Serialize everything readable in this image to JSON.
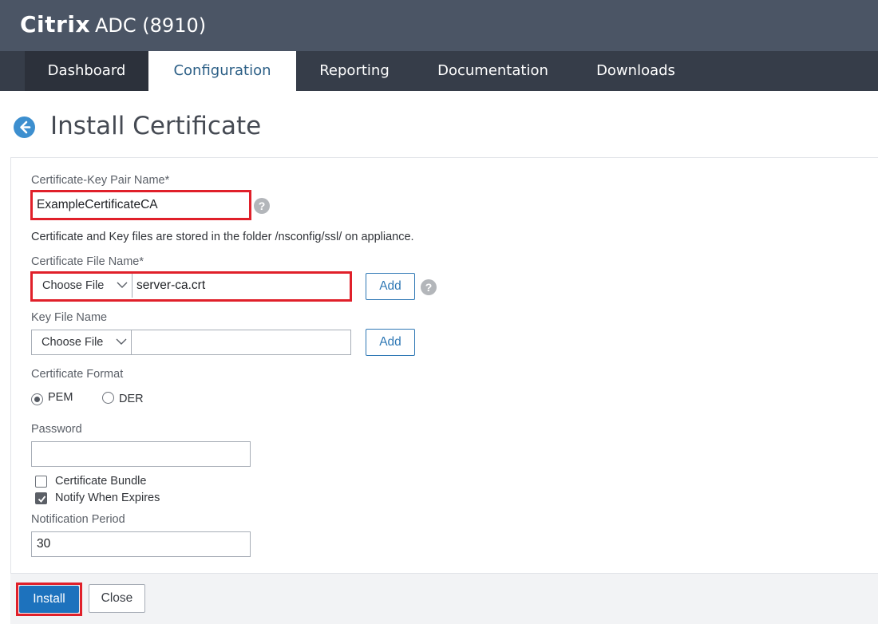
{
  "header": {
    "brand_bold": "Citrix",
    "brand_model": "ADC (8910)"
  },
  "nav": {
    "tabs": [
      {
        "label": "Dashboard"
      },
      {
        "label": "Configuration",
        "active": true
      },
      {
        "label": "Reporting"
      },
      {
        "label": "Documentation"
      },
      {
        "label": "Downloads"
      }
    ]
  },
  "page": {
    "title": "Install Certificate"
  },
  "form": {
    "cert_key_pair_label": "Certificate-Key Pair Name*",
    "cert_key_pair_value": "ExampleCertificateCA",
    "storage_note": "Certificate and Key files are stored in the folder /nsconfig/ssl/ on appliance.",
    "cert_file_label": "Certificate File Name*",
    "cert_file_choose": "Choose File",
    "cert_file_value": "server-ca.crt",
    "key_file_label": "Key File Name",
    "key_file_choose": "Choose File",
    "key_file_value": "",
    "add_label": "Add",
    "format_label": "Certificate Format",
    "format_options": [
      "PEM",
      "DER"
    ],
    "format_selected": "PEM",
    "password_label": "Password",
    "password_value": "",
    "bundle_label": "Certificate Bundle",
    "bundle_checked": false,
    "notify_label": "Notify When Expires",
    "notify_checked": true,
    "notification_period_label": "Notification Period",
    "notification_period_value": "30",
    "help_glyph": "?"
  },
  "footer": {
    "install_label": "Install",
    "close_label": "Close"
  },
  "colors": {
    "topbar": "#4b5565",
    "navbar": "#363d49",
    "accent": "#1d72bd",
    "highlight": "#e0202a"
  },
  "icons": {
    "back": "back-arrow-icon",
    "help": "help-icon",
    "dropdown": "chevron-down-icon",
    "check": "checkmark-icon"
  }
}
